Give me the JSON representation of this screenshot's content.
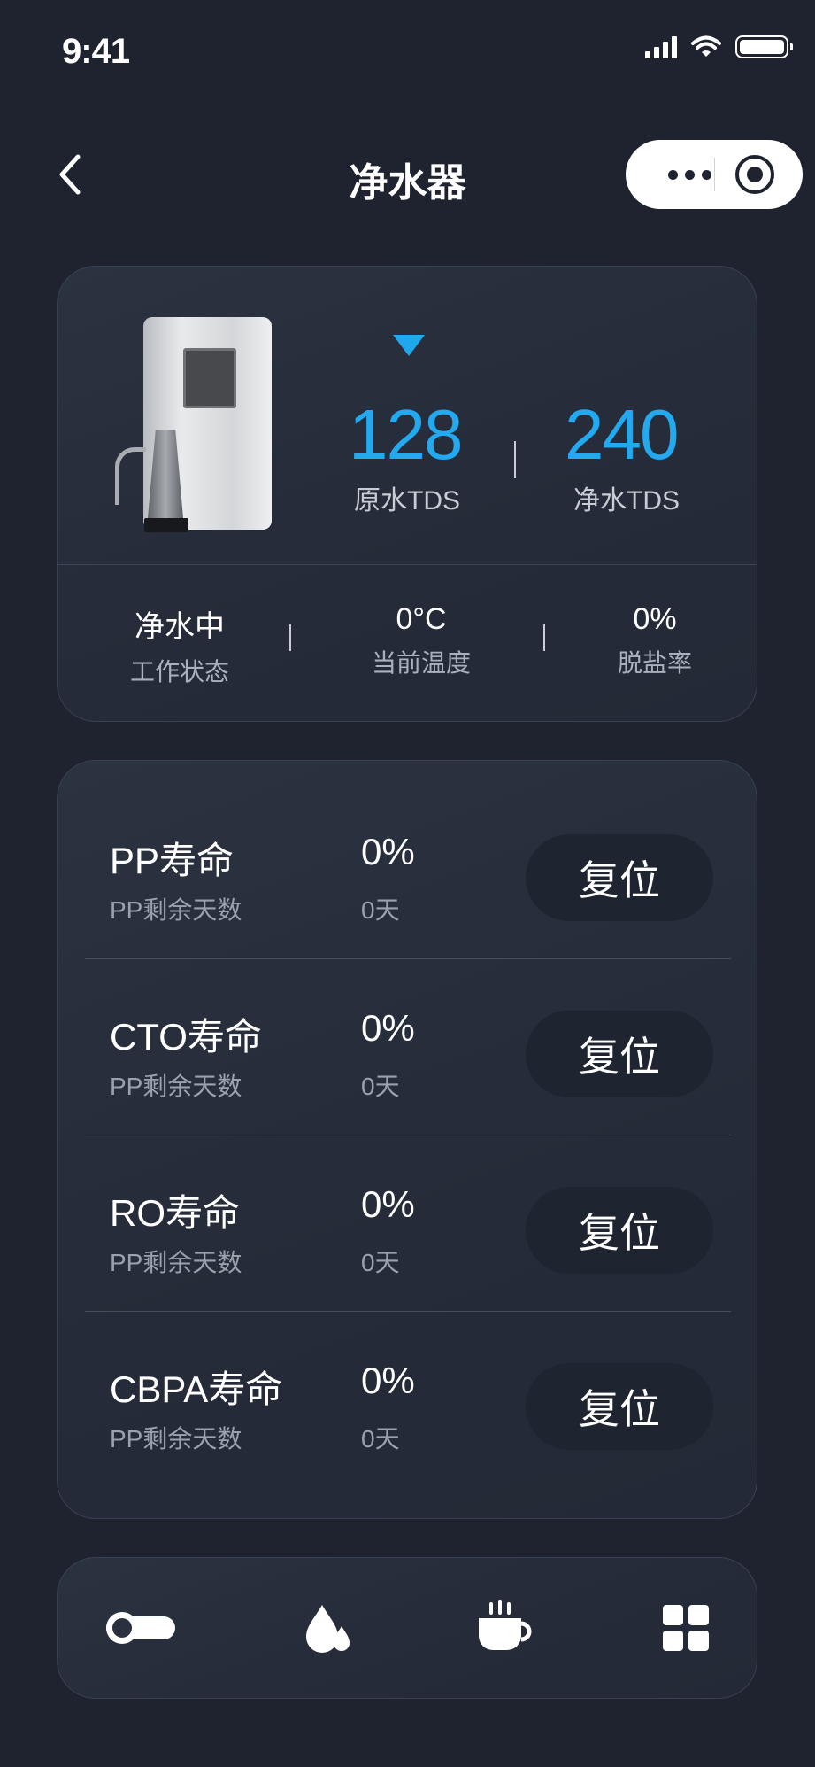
{
  "status_bar": {
    "time": "9:41"
  },
  "nav": {
    "title": "净水器"
  },
  "overview": {
    "raw_tds": {
      "value": "128",
      "label": "原水TDS"
    },
    "pure_tds": {
      "value": "240",
      "label": "净水TDS"
    },
    "stats": [
      {
        "value": "净水中",
        "label": "工作状态"
      },
      {
        "value": "0°C",
        "label": "当前温度"
      },
      {
        "value": "0%",
        "label": "脱盐率"
      }
    ]
  },
  "filters": [
    {
      "name": "PP寿命",
      "sub": "PP剩余天数",
      "percent": "0%",
      "days": "0天",
      "reset_label": "复位"
    },
    {
      "name": "CTO寿命",
      "sub": "PP剩余天数",
      "percent": "0%",
      "days": "0天",
      "reset_label": "复位"
    },
    {
      "name": "RO寿命",
      "sub": "PP剩余天数",
      "percent": "0%",
      "days": "0天",
      "reset_label": "复位"
    },
    {
      "name": "CBPA寿命",
      "sub": "PP剩余天数",
      "percent": "0%",
      "days": "0天",
      "reset_label": "复位"
    }
  ],
  "bottom_tabs": [
    {
      "icon": "toggle-icon"
    },
    {
      "icon": "water-drops-icon"
    },
    {
      "icon": "hot-cup-icon"
    },
    {
      "icon": "grid-icon"
    }
  ],
  "colors": {
    "background": "#1f2330",
    "accent": "#22a9ef",
    "card": "#282f3c",
    "button": "#1f2431"
  }
}
